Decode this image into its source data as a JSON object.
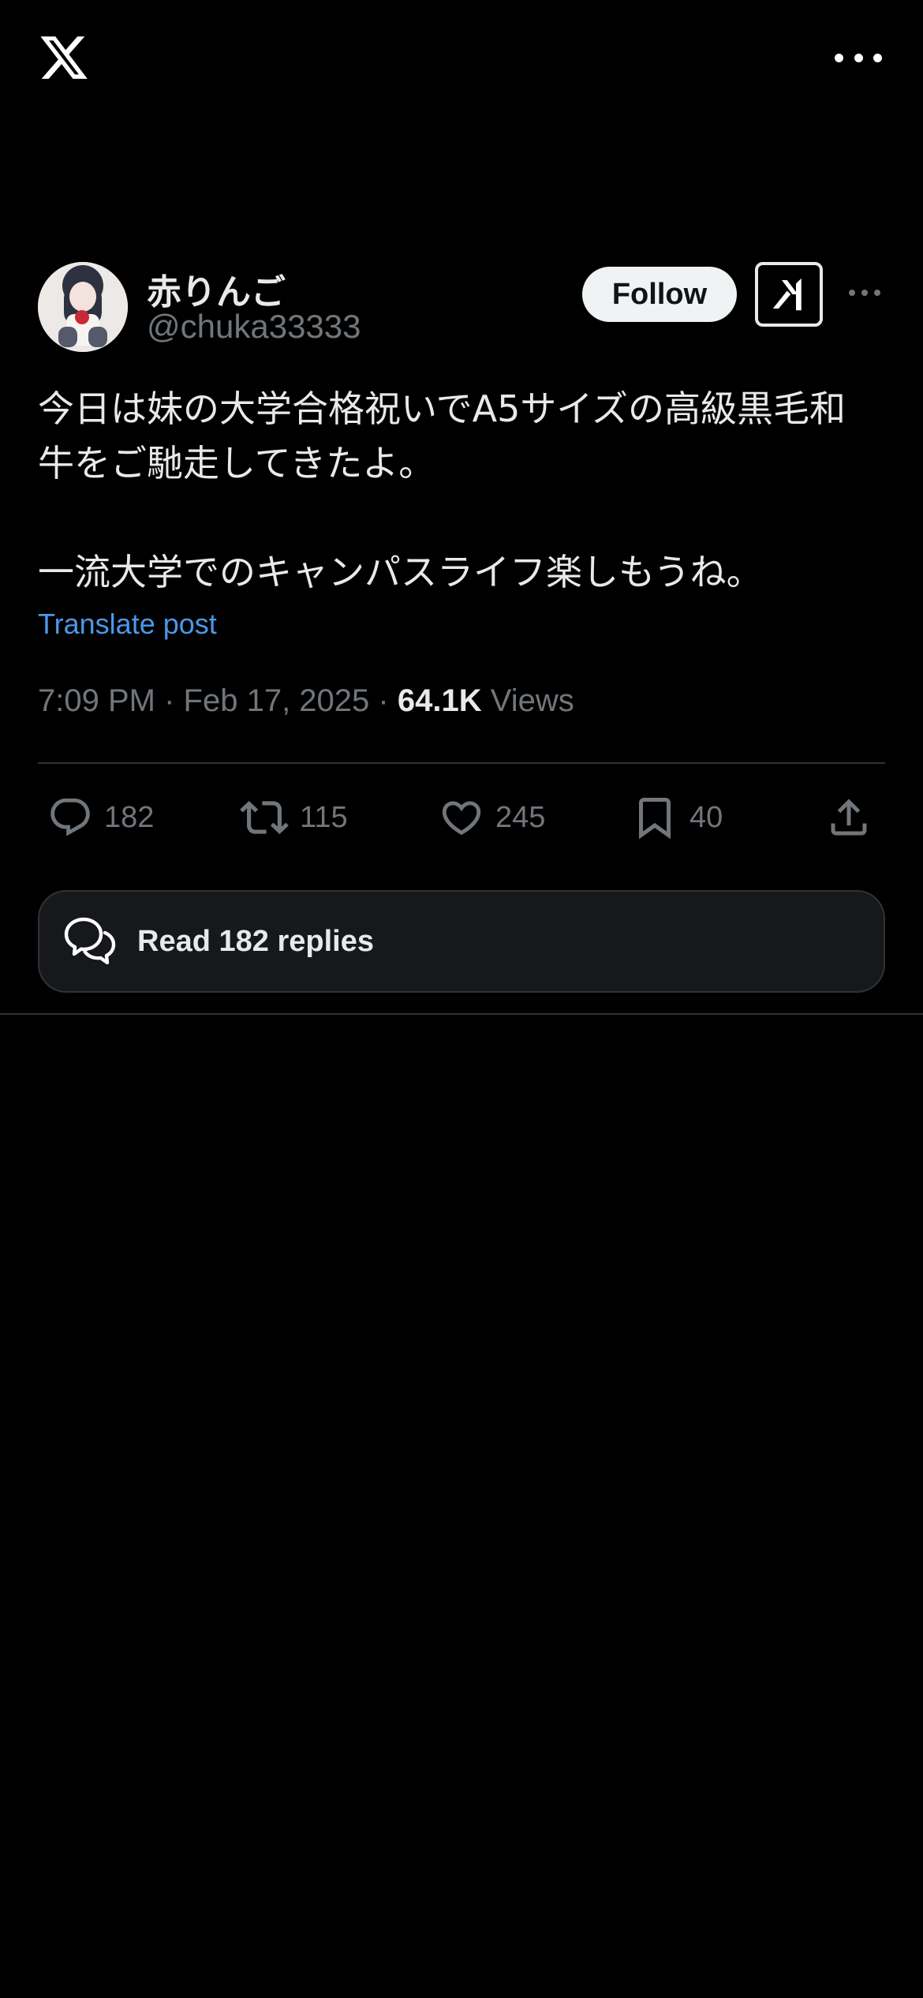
{
  "app": {
    "logo_icon": "x-logo-icon",
    "more_icon": "more-horizontal-icon"
  },
  "author": {
    "display_name": "赤りんご",
    "handle": "@chuka33333",
    "avatar_icon": "avatar-image"
  },
  "header": {
    "follow_label": "Follow",
    "grok_icon": "grok-icon",
    "more_icon": "more-horizontal-icon"
  },
  "tweet": {
    "text": "今日は妹の大学合格祝いでA5サイズの高級黒毛和\n牛をご馳走してきたよ。\n\n一流大学でのキャンパスライフ楽しもうね。",
    "translate_label": "Translate post",
    "time": "7:09 PM",
    "date": "Feb 17, 2025",
    "views_count": "64.1K",
    "views_label": "Views",
    "separator": "·"
  },
  "actions": {
    "replies": "182",
    "reposts": "115",
    "likes": "245",
    "bookmarks": "40"
  },
  "read_replies": {
    "label": "Read 182 replies"
  },
  "colors": {
    "background": "#000000",
    "text_primary": "#e7e9ea",
    "text_secondary": "#71767b",
    "link": "#4a99e9",
    "divider": "#2f3336",
    "button_bg": "#eff3f4"
  }
}
